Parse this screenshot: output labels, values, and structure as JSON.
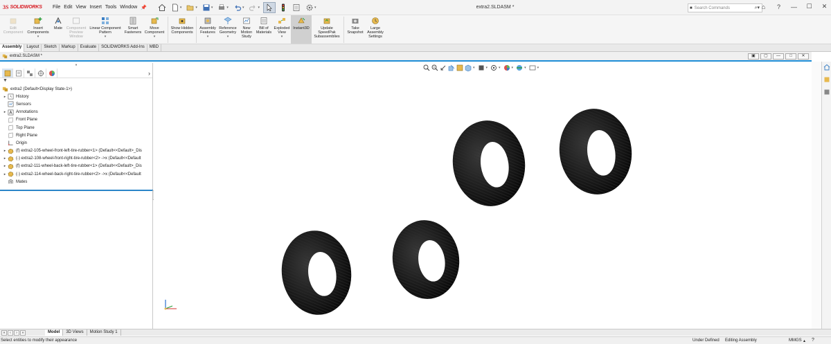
{
  "app": {
    "logo_ds": "3S",
    "logo_text": "SOLIDWORKS",
    "document_title": "extra2.SLDASM *",
    "search_placeholder": "Search Commands",
    "menus": [
      "File",
      "Edit",
      "View",
      "Insert",
      "Tools",
      "Window"
    ],
    "window_controls": [
      "⌂",
      "?",
      "—",
      "☐",
      "✕"
    ]
  },
  "ribbon": {
    "buttons": [
      {
        "label": "Edit Component",
        "icon": "edit-component-icon",
        "disabled": true
      },
      {
        "label": "Insert Components",
        "icon": "insert-components-icon",
        "disabled": false,
        "dropdown": true
      },
      {
        "label": "Mate",
        "icon": "mate-icon",
        "disabled": false
      },
      {
        "label": "Component Preview Window",
        "icon": "preview-window-icon",
        "disabled": true
      },
      {
        "label": "Linear Component Pattern",
        "icon": "linear-pattern-icon",
        "disabled": false,
        "dropdown": true
      },
      {
        "label": "Smart Fasteners",
        "icon": "smart-fasteners-icon",
        "disabled": false
      },
      {
        "label": "Move Component",
        "icon": "move-component-icon",
        "disabled": false,
        "dropdown": true
      },
      {
        "label": "Show Hidden Components",
        "icon": "show-hidden-icon",
        "disabled": false
      },
      {
        "label": "Assembly Features",
        "icon": "assembly-features-icon",
        "disabled": false,
        "dropdown": true
      },
      {
        "label": "Reference Geometry",
        "icon": "reference-geometry-icon",
        "disabled": false,
        "dropdown": true
      },
      {
        "label": "New Motion Study",
        "icon": "motion-study-icon",
        "disabled": false
      },
      {
        "label": "Bill of Materials",
        "icon": "bom-icon",
        "disabled": false
      },
      {
        "label": "Exploded View",
        "icon": "exploded-view-icon",
        "disabled": false,
        "dropdown": true
      },
      {
        "label": "Instant3D",
        "icon": "instant3d-icon",
        "disabled": false,
        "selected": true
      },
      {
        "label": "Update SpeedPak Subassemblies",
        "icon": "speedpak-icon",
        "disabled": false
      },
      {
        "label": "Take Snapshot",
        "icon": "snapshot-icon",
        "disabled": false
      },
      {
        "label": "Large Assembly Settings",
        "icon": "large-assembly-icon",
        "disabled": false
      }
    ]
  },
  "tabs": [
    "Assembly",
    "Layout",
    "Sketch",
    "Markup",
    "Evaluate",
    "SOLIDWORKS Add-Ins",
    "MBD"
  ],
  "document_tab": "extra2.SLDASM *",
  "feature_manager": {
    "root": "extra2  (Default<Display State-1>)",
    "items": [
      {
        "label": "History",
        "icon": "history-icon",
        "expandable": true
      },
      {
        "label": "Sensors",
        "icon": "sensors-icon",
        "expandable": false
      },
      {
        "label": "Annotations",
        "icon": "annotations-icon",
        "expandable": true
      },
      {
        "label": "Front Plane",
        "icon": "plane-icon",
        "expandable": false
      },
      {
        "label": "Top Plane",
        "icon": "plane-icon",
        "expandable": false
      },
      {
        "label": "Right Plane",
        "icon": "plane-icon",
        "expandable": false
      },
      {
        "label": "Origin",
        "icon": "origin-icon",
        "expandable": false
      },
      {
        "label": "(f) extra2-105-wheel-front-left-tire-rubber<1> (Default<<Default>_Dis",
        "icon": "part-icon",
        "expandable": true
      },
      {
        "label": "(-) extra2-108-wheel-front-right-tire-rubber<2> ->x (Default<<Default",
        "icon": "part-icon",
        "expandable": true
      },
      {
        "label": "(f) extra2-111-wheel-back-left-tire-rubber<1> (Default<<Default>_Dis",
        "icon": "part-icon",
        "expandable": true
      },
      {
        "label": "(-) extra2-114-wheel-back-right-tire-rubber<2> ->x (Default<<Default",
        "icon": "part-icon",
        "expandable": true
      },
      {
        "label": "Mates",
        "icon": "mates-icon",
        "expandable": false
      }
    ]
  },
  "model_tabs": [
    "Model",
    "3D Views",
    "Motion Study 1"
  ],
  "status": {
    "message": "Select entities to modify their appearance",
    "definition": "Under Defined",
    "mode": "Editing Assembly",
    "units": "MMGS",
    "units_caret": "▴",
    "help": "?"
  },
  "colors": {
    "accent": "#1e8dd6",
    "brand": "#d71920",
    "tire": "#1a1a1a"
  }
}
